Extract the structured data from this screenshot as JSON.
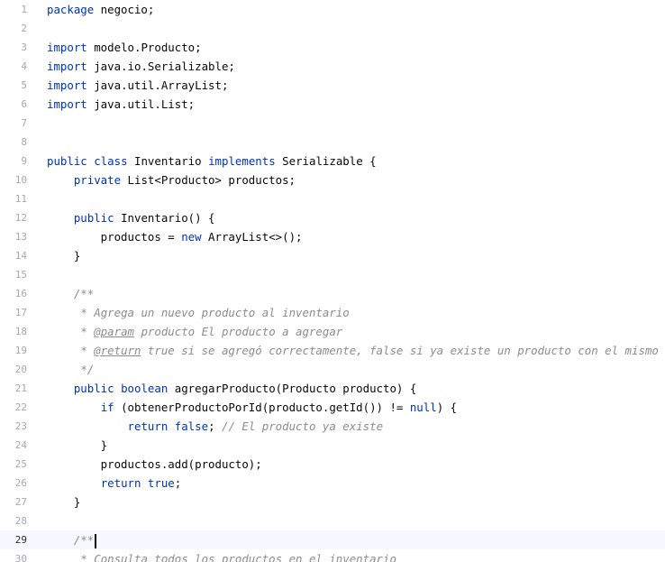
{
  "editor": {
    "file": {
      "language": "java",
      "current_line": 29,
      "lines": [
        {
          "n": "1",
          "t": [
            [
              "package",
              "kw"
            ],
            [
              " negocio;",
              ""
            ]
          ]
        },
        {
          "n": "2",
          "t": []
        },
        {
          "n": "3",
          "t": [
            [
              "import",
              "kw"
            ],
            [
              " modelo.Producto;",
              ""
            ]
          ]
        },
        {
          "n": "4",
          "t": [
            [
              "import",
              "kw"
            ],
            [
              " java.io.Serializable;",
              ""
            ]
          ]
        },
        {
          "n": "5",
          "t": [
            [
              "import",
              "kw"
            ],
            [
              " java.util.ArrayList;",
              ""
            ]
          ]
        },
        {
          "n": "6",
          "t": [
            [
              "import",
              "kw"
            ],
            [
              " java.util.List;",
              ""
            ]
          ]
        },
        {
          "n": "7",
          "t": []
        },
        {
          "n": "8",
          "t": []
        },
        {
          "n": "9",
          "t": [
            [
              "public",
              "kw"
            ],
            [
              " ",
              ""
            ],
            [
              "class",
              "kw"
            ],
            [
              " Inventario ",
              ""
            ],
            [
              "implements",
              "kw"
            ],
            [
              " Serializable {",
              ""
            ]
          ]
        },
        {
          "n": "10",
          "t": [
            [
              "    ",
              ""
            ],
            [
              "private",
              "kw"
            ],
            [
              " List<Producto> productos;",
              ""
            ]
          ]
        },
        {
          "n": "11",
          "t": []
        },
        {
          "n": "12",
          "t": [
            [
              "    ",
              ""
            ],
            [
              "public",
              "kw"
            ],
            [
              " Inventario() {",
              ""
            ]
          ]
        },
        {
          "n": "13",
          "t": [
            [
              "        productos = ",
              ""
            ],
            [
              "new",
              "kw"
            ],
            [
              " ArrayList<>();",
              ""
            ]
          ]
        },
        {
          "n": "14",
          "t": [
            [
              "    }",
              ""
            ]
          ]
        },
        {
          "n": "15",
          "t": []
        },
        {
          "n": "16",
          "t": [
            [
              "    ",
              ""
            ],
            [
              "/**",
              "cm"
            ]
          ]
        },
        {
          "n": "17",
          "t": [
            [
              "     ",
              ""
            ],
            [
              "* Agrega un nuevo producto al inventario",
              "cm"
            ]
          ]
        },
        {
          "n": "18",
          "t": [
            [
              "     ",
              ""
            ],
            [
              "* ",
              "cm"
            ],
            [
              "@param",
              "tag"
            ],
            [
              " producto El producto a agregar",
              "cm"
            ]
          ]
        },
        {
          "n": "19",
          "t": [
            [
              "     ",
              ""
            ],
            [
              "* ",
              "cm"
            ],
            [
              "@return",
              "tag"
            ],
            [
              " true si se agregó correctamente, false si ya existe un producto con el mismo ID",
              "cm"
            ]
          ]
        },
        {
          "n": "20",
          "t": [
            [
              "     ",
              ""
            ],
            [
              "*/",
              "cm"
            ]
          ]
        },
        {
          "n": "21",
          "t": [
            [
              "    ",
              ""
            ],
            [
              "public",
              "kw"
            ],
            [
              " ",
              ""
            ],
            [
              "boolean",
              "kw"
            ],
            [
              " agregarProducto(Producto producto) {",
              ""
            ]
          ]
        },
        {
          "n": "22",
          "t": [
            [
              "        ",
              ""
            ],
            [
              "if",
              "kw"
            ],
            [
              " (obtenerProductoPorId(producto.getId()) != ",
              ""
            ],
            [
              "null",
              "kw"
            ],
            [
              ") {",
              ""
            ]
          ]
        },
        {
          "n": "23",
          "t": [
            [
              "            ",
              ""
            ],
            [
              "return",
              "kw"
            ],
            [
              " ",
              ""
            ],
            [
              "false",
              "kw"
            ],
            [
              "; ",
              ""
            ],
            [
              "// El producto ya existe",
              "cm"
            ]
          ]
        },
        {
          "n": "24",
          "t": [
            [
              "        }",
              ""
            ]
          ]
        },
        {
          "n": "25",
          "t": [
            [
              "        productos.add(producto);",
              ""
            ]
          ]
        },
        {
          "n": "26",
          "t": [
            [
              "        ",
              ""
            ],
            [
              "return",
              "kw"
            ],
            [
              " ",
              ""
            ],
            [
              "true",
              "kw"
            ],
            [
              ";",
              ""
            ]
          ]
        },
        {
          "n": "27",
          "t": [
            [
              "    }",
              ""
            ]
          ]
        },
        {
          "n": "28",
          "t": []
        },
        {
          "n": "29",
          "t": [
            [
              "    ",
              ""
            ],
            [
              "/**",
              "cm"
            ]
          ]
        },
        {
          "n": "30",
          "t": [
            [
              "     ",
              ""
            ],
            [
              "* Consulta todos los productos en el inventario",
              "cm"
            ]
          ]
        }
      ]
    }
  }
}
